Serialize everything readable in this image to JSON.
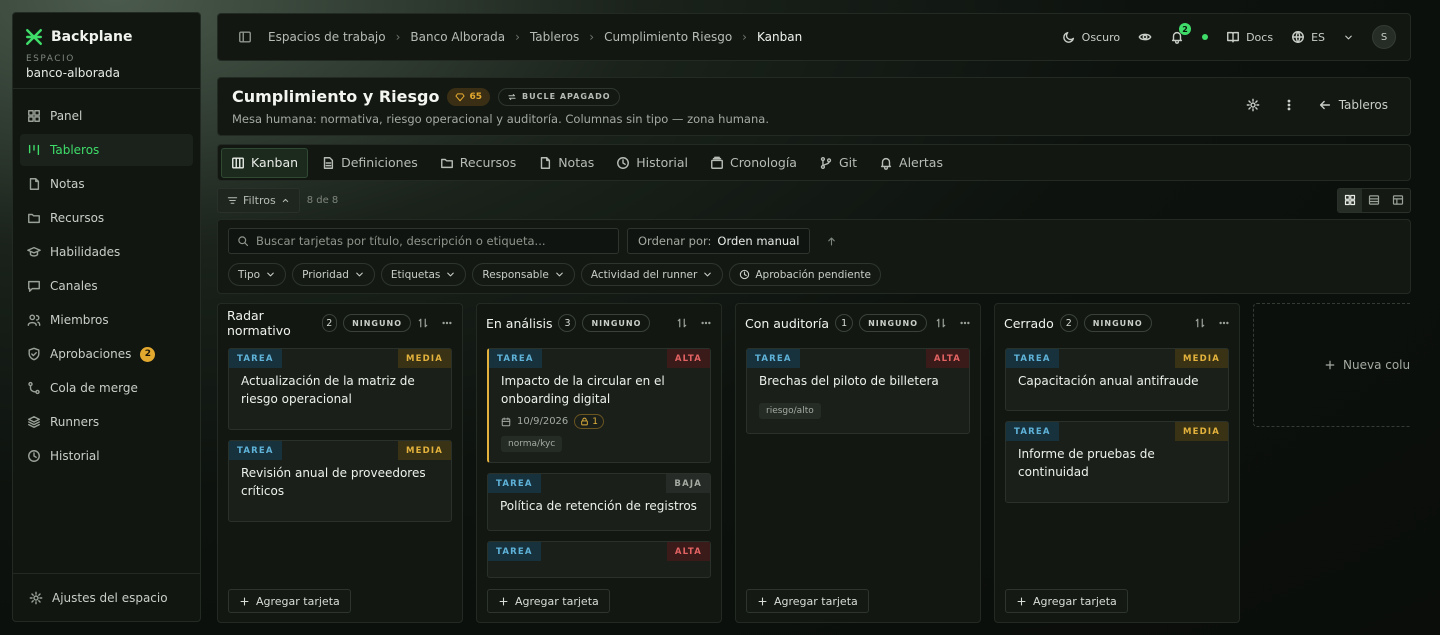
{
  "brand": {
    "name": "Backplane"
  },
  "workspace": {
    "label": "ESPACIO",
    "name": "banco-alborada"
  },
  "sidebar": {
    "items": [
      {
        "label": "Panel",
        "icon": "grid-icon"
      },
      {
        "label": "Tableros",
        "icon": "kanban-icon",
        "active": true
      },
      {
        "label": "Notas",
        "icon": "note-icon"
      },
      {
        "label": "Recursos",
        "icon": "folder-icon"
      },
      {
        "label": "Habilidades",
        "icon": "cap-icon"
      },
      {
        "label": "Canales",
        "icon": "chat-icon"
      },
      {
        "label": "Miembros",
        "icon": "users-icon"
      },
      {
        "label": "Aprobaciones",
        "icon": "shield-icon",
        "badge": "2"
      },
      {
        "label": "Cola de merge",
        "icon": "merge-icon"
      },
      {
        "label": "Runners",
        "icon": "layers-icon"
      },
      {
        "label": "Historial",
        "icon": "clock-icon"
      }
    ],
    "footer": "Ajustes del espacio"
  },
  "topbar": {
    "breadcrumbs": [
      "Espacios de trabajo",
      "Banco Alborada",
      "Tableros",
      "Cumplimiento Riesgo",
      "Kanban"
    ],
    "theme": "Oscuro",
    "notifications": "2",
    "docs": "Docs",
    "language": "ES",
    "avatar": "S"
  },
  "board": {
    "title": "Cumplimiento y Riesgo",
    "score": "65",
    "loop": "BUCLE APAGADO",
    "description": "Mesa humana: normativa, riesgo operacional y auditoría. Columnas sin tipo — zona humana.",
    "back": "Tableros"
  },
  "tabs": [
    "Kanban",
    "Definiciones",
    "Recursos",
    "Notas",
    "Historial",
    "Cronología",
    "Git",
    "Alertas"
  ],
  "filters": {
    "label": "Filtros",
    "count": "8 de 8"
  },
  "search": {
    "placeholder": "Buscar tarjetas por título, descripción o etiqueta...",
    "sort_label": "Ordenar por:",
    "sort_value": "Orden manual"
  },
  "chips": [
    "Tipo",
    "Prioridad",
    "Etiquetas",
    "Responsable",
    "Actividad del runner",
    "Aprobación pendiente"
  ],
  "columns": [
    {
      "title": "Radar normativo",
      "count": "2",
      "tag": "NINGUNO",
      "cards": [
        {
          "type": "TAREA",
          "priority": "MEDIA",
          "title": "Actualización de la matriz de riesgo operacional"
        },
        {
          "type": "TAREA",
          "priority": "MEDIA",
          "title": "Revisión anual de proveedores críticos"
        }
      ]
    },
    {
      "title": "En análisis",
      "count": "3",
      "tag": "NINGUNO",
      "cards": [
        {
          "type": "TAREA",
          "priority": "ALTA",
          "title": "Impacto de la circular en el onboarding digital",
          "date": "10/9/2026",
          "lock": "1",
          "label": "norma/kyc"
        },
        {
          "type": "TAREA",
          "priority": "BAJA",
          "title": "Política de retención de registros"
        },
        {
          "type": "TAREA",
          "priority": "ALTA",
          "title": ""
        }
      ]
    },
    {
      "title": "Con auditoría",
      "count": "1",
      "tag": "NINGUNO",
      "cards": [
        {
          "type": "TAREA",
          "priority": "ALTA",
          "title": "Brechas del piloto de billetera",
          "label": "riesgo/alto"
        }
      ]
    },
    {
      "title": "Cerrado",
      "count": "2",
      "tag": "NINGUNO",
      "cards": [
        {
          "type": "TAREA",
          "priority": "MEDIA",
          "title": "Capacitación anual antifraude"
        },
        {
          "type": "TAREA",
          "priority": "MEDIA",
          "title": "Informe de pruebas de continuidad"
        }
      ]
    }
  ],
  "add_card_label": "Agregar tarjeta",
  "new_column_label": "Nueva colum"
}
